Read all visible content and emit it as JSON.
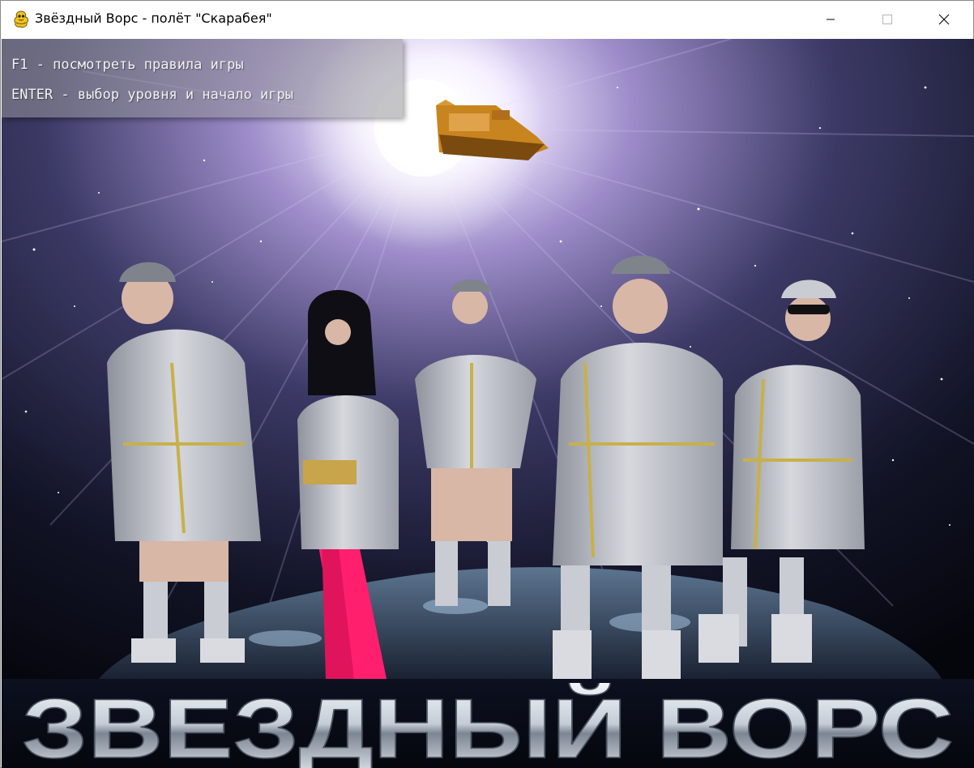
{
  "window": {
    "title": "Звёздный Ворс - полёт \"Скарабея\"",
    "icon": "pygame-snake-icon",
    "controls": [
      "minimize-icon",
      "maximize-icon",
      "close-icon"
    ]
  },
  "help": {
    "line1": "F1 - посмотреть правила игры",
    "line2": "ENTER - выбор уровня и начало игры"
  },
  "logo": {
    "text": "ЗВЕЗДНЫЙ ВОРС"
  },
  "colors": {
    "space": "#0b0b18",
    "nebula": "#b9a6e0",
    "suit": "#b9bcc3",
    "trim": "#c8b04a",
    "leggings": "#ff1f6d",
    "ship": "#c8841e",
    "logo_metal": "#dfe6ee"
  }
}
